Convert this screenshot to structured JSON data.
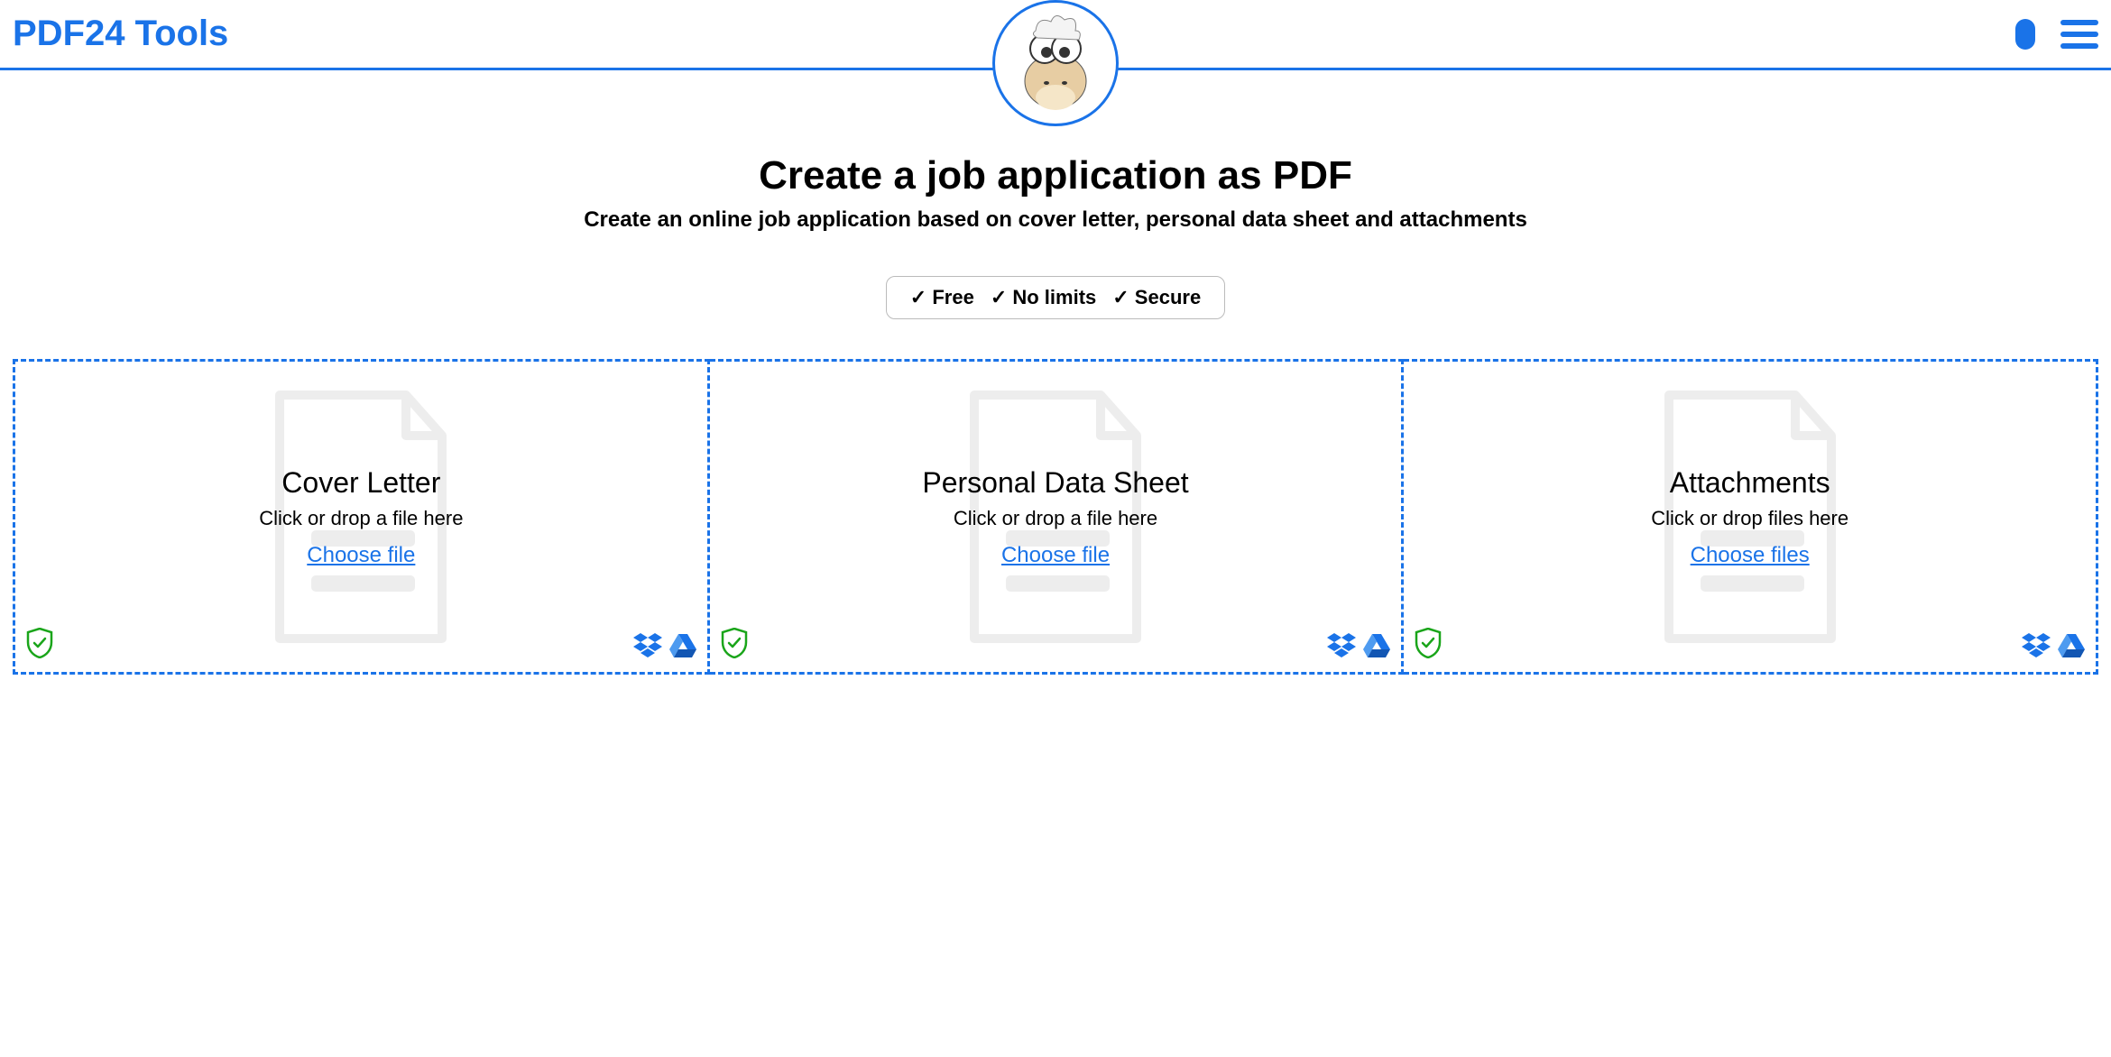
{
  "header": {
    "brand": "PDF24 Tools"
  },
  "page": {
    "title": "Create a job application as PDF",
    "subtitle": "Create an online job application based on cover letter, personal data sheet and attachments"
  },
  "badges": {
    "free": "✓ Free",
    "nolimits": "✓ No limits",
    "secure": "✓ Secure"
  },
  "dropzones": [
    {
      "title": "Cover Letter",
      "hint": "Click or drop a file here",
      "choose": "Choose file"
    },
    {
      "title": "Personal Data Sheet",
      "hint": "Click or drop a file here",
      "choose": "Choose file"
    },
    {
      "title": "Attachments",
      "hint": "Click or drop files here",
      "choose": "Choose files"
    }
  ]
}
